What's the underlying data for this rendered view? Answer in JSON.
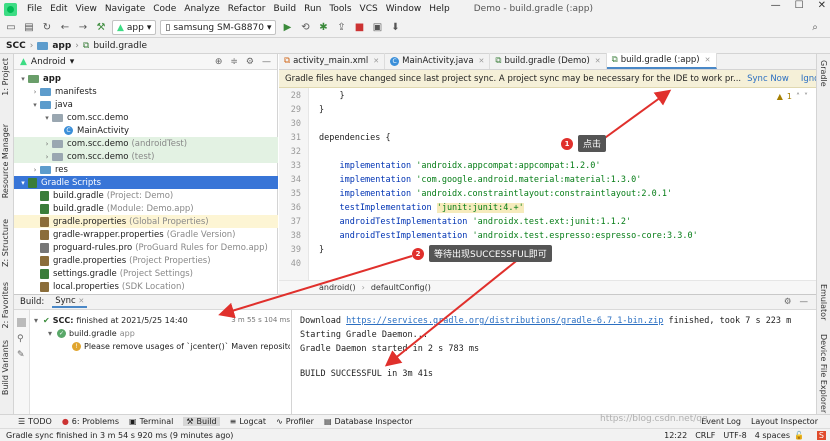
{
  "menubar": {
    "items": [
      "File",
      "Edit",
      "View",
      "Navigate",
      "Code",
      "Analyze",
      "Refactor",
      "Build",
      "Run",
      "Tools",
      "VCS",
      "Window",
      "Help"
    ],
    "window_title": "Demo - build.gradle (:app)"
  },
  "toolbar": {
    "config": "app",
    "device": "samsung SM-G8870"
  },
  "breadcrumb": [
    "SCC",
    "app",
    "build.gradle"
  ],
  "left_stripe": [
    "1: Project",
    "Resource Manager",
    "Z: Structure",
    "2: Favorites",
    "Build Variants"
  ],
  "right_stripe": [
    "Gradle",
    "Emulator",
    "Device File Explorer"
  ],
  "project": {
    "view": "Android",
    "tree": [
      {
        "label": "app",
        "hint": ""
      },
      {
        "label": "manifests",
        "hint": ""
      },
      {
        "label": "java",
        "hint": ""
      },
      {
        "label": "com.scc.demo",
        "hint": ""
      },
      {
        "label": "MainActivity",
        "hint": ""
      },
      {
        "label": "com.scc.demo",
        "hint": "(androidTest)"
      },
      {
        "label": "com.scc.demo",
        "hint": "(test)"
      },
      {
        "label": "res",
        "hint": ""
      },
      {
        "label": "Gradle Scripts",
        "hint": ""
      },
      {
        "label": "build.gradle",
        "hint": "(Project: Demo)"
      },
      {
        "label": "build.gradle",
        "hint": "(Module: Demo.app)"
      },
      {
        "label": "gradle.properties",
        "hint": "(Global Properties)"
      },
      {
        "label": "gradle-wrapper.properties",
        "hint": "(Gradle Version)"
      },
      {
        "label": "proguard-rules.pro",
        "hint": "(ProGuard Rules for Demo.app)"
      },
      {
        "label": "gradle.properties",
        "hint": "(Project Properties)"
      },
      {
        "label": "settings.gradle",
        "hint": "(Project Settings)"
      },
      {
        "label": "local.properties",
        "hint": "(SDK Location)"
      }
    ]
  },
  "editor": {
    "tabs": [
      "activity_main.xml",
      "MainActivity.java",
      "build.gradle (Demo)",
      "build.gradle (:app)"
    ],
    "banner": "Gradle files have changed since last project sync. A project sync may be necessary for the IDE to work pr...",
    "sync_now": "Sync Now",
    "ignore": "Ignore these changes",
    "warning_count": "1",
    "line_numbers": [
      "28",
      "29",
      "30",
      "31",
      "32",
      "33",
      "34",
      "35",
      "36",
      "37",
      "38",
      "39",
      "40"
    ],
    "lines": {
      "l28": "    }",
      "l29": "}",
      "l30": "",
      "l31": "dependencies {",
      "l32": "",
      "l33_kw": "    implementation ",
      "l33_str": "'androidx.appcompat:appcompat:1.2.0'",
      "l34_kw": "    implementation ",
      "l34_str": "'com.google.android.material:material:1.3.0'",
      "l35_kw": "    implementation ",
      "l35_str": "'androidx.constraintlayout:constraintlayout:2.0.1'",
      "l36_kw": "    testImplementation ",
      "l36_str": "'junit:junit:4.+'",
      "l37_kw": "    androidTestImplementation ",
      "l37_str": "'androidx.test.ext:junit:1.1.2'",
      "l38_kw": "    androidTestImplementation ",
      "l38_str": "'androidx.test.espresso:espresso-core:3.3.0'",
      "l39": "}"
    },
    "footer_crumbs": [
      "android()",
      "defaultConfig()"
    ]
  },
  "build": {
    "title": "Build:",
    "tab": "Sync",
    "root_label": "SCC:",
    "root_text": "finished at 2021/5/25 14:40",
    "root_time": "3 m 55 s 104 ms",
    "child": "build.gradle",
    "child_hint": "app",
    "warning": "Please remove usages of `jcenter()` Maven repository fro",
    "output": {
      "download_prefix": "Download ",
      "download_url": "https://services.gradle.org/distributions/gradle-6.7.1-bin.zip",
      "download_suffix": " finished, took 7 s 223 m",
      "l2": "Starting Gradle Daemon...",
      "l3": "Gradle Daemon started in 2 s 783 ms",
      "l4": "BUILD SUCCESSFUL in 3m 41s"
    }
  },
  "bottom_tabs": [
    "TODO",
    "6: Problems",
    "Terminal",
    "Build",
    "Logcat",
    "Profiler",
    "Database Inspector",
    "Event Log",
    "Layout Inspector"
  ],
  "status": {
    "message": "Gradle sync finished in 3 m 54 s 920 ms (9 minutes ago)",
    "position": "12:22",
    "line_sep": "CRLF",
    "encoding": "UTF-8",
    "indent": "4 spaces"
  },
  "annotations": {
    "step1_num": "1",
    "step1_text": "点击",
    "step2_num": "2",
    "step2_text": "等待出现SUCCESSFUL即可"
  },
  "watermark": "https://blog.csdn.net/qq_..."
}
